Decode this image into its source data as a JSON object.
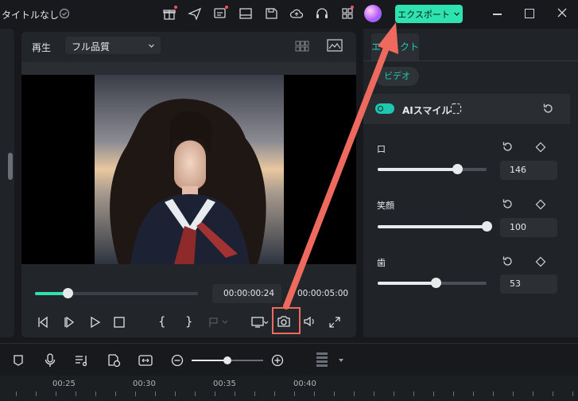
{
  "window": {
    "title": "タイトルなし"
  },
  "toolbar": {
    "export_label": "エクスポート",
    "icons": [
      "gift-icon",
      "send-icon",
      "subtitle-icon",
      "layout-icon",
      "save-icon",
      "cloud-icon",
      "headset-icon",
      "grid-icon",
      "avatar-icon"
    ]
  },
  "player": {
    "play_label": "再生",
    "quality_label": "フル品質",
    "current_time": "00:00:00:24",
    "separator": "/",
    "total_time": "00:00:05:00",
    "progress_fraction": 0.2
  },
  "right_panel": {
    "tab_label": "エフェクト",
    "pill_label": "ビデオ",
    "effect_name": "AIスマイル",
    "toggle_on": true,
    "params": [
      {
        "label": "口",
        "value": "146",
        "fraction": 0.73
      },
      {
        "label": "笑顔",
        "value": "100",
        "fraction": 1.0
      },
      {
        "label": "歯",
        "value": "53",
        "fraction": 0.53
      }
    ]
  },
  "timeline": {
    "ticks": [
      "00:25",
      "00:30",
      "00:35",
      "00:40"
    ]
  },
  "colors": {
    "accent": "#2fe3b0",
    "teal_text": "#1ec8b0",
    "annotation": "#ef6a5e"
  }
}
